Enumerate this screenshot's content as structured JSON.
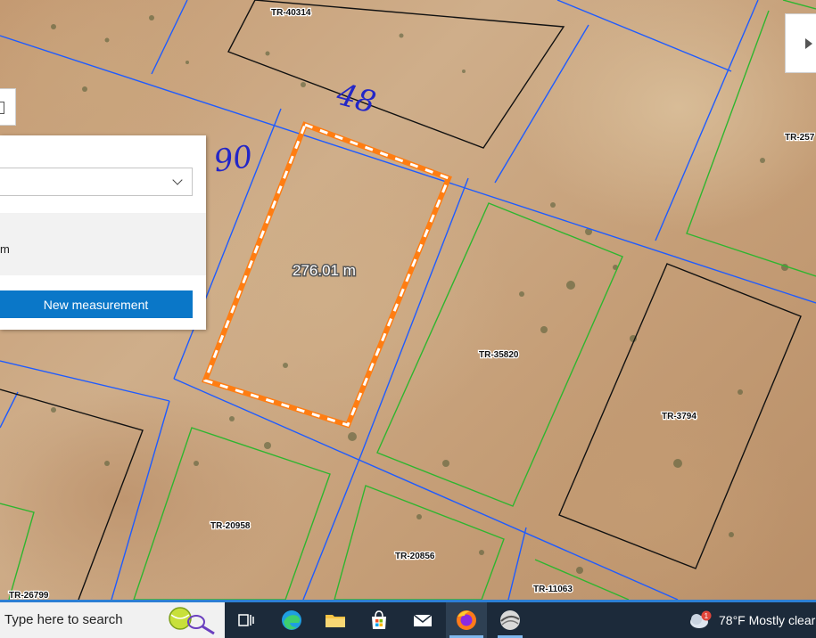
{
  "map": {
    "parcels": [
      {
        "id": "TR-40314"
      },
      {
        "id": "TR-257"
      },
      {
        "id": "TR-35820"
      },
      {
        "id": "TR-3794"
      },
      {
        "id": "TR-20958"
      },
      {
        "id": "TR-20856"
      },
      {
        "id": "TR-26799"
      },
      {
        "id": "TR-11063"
      }
    ],
    "measurement": {
      "label": "276.01 m"
    },
    "annotations": [
      "48",
      "90"
    ]
  },
  "panel": {
    "result_line1": "",
    "result_line2": "m",
    "new_measurement_label": "New measurement"
  },
  "taskbar": {
    "search_placeholder": "Type here to search",
    "weather": "78°F  Mostly clear",
    "notification_badge": "1",
    "icons": [
      "task-view-icon",
      "edge-icon",
      "file-explorer-icon",
      "store-icon",
      "mail-icon",
      "firefox-icon",
      "arcgis-pro-icon"
    ]
  },
  "colors": {
    "parcel_blue": "#1e5bff",
    "parcel_green": "#2fb52f",
    "parcel_black": "#111111",
    "measure_orange": "#ff7d12",
    "accent": "#0a77c8"
  }
}
